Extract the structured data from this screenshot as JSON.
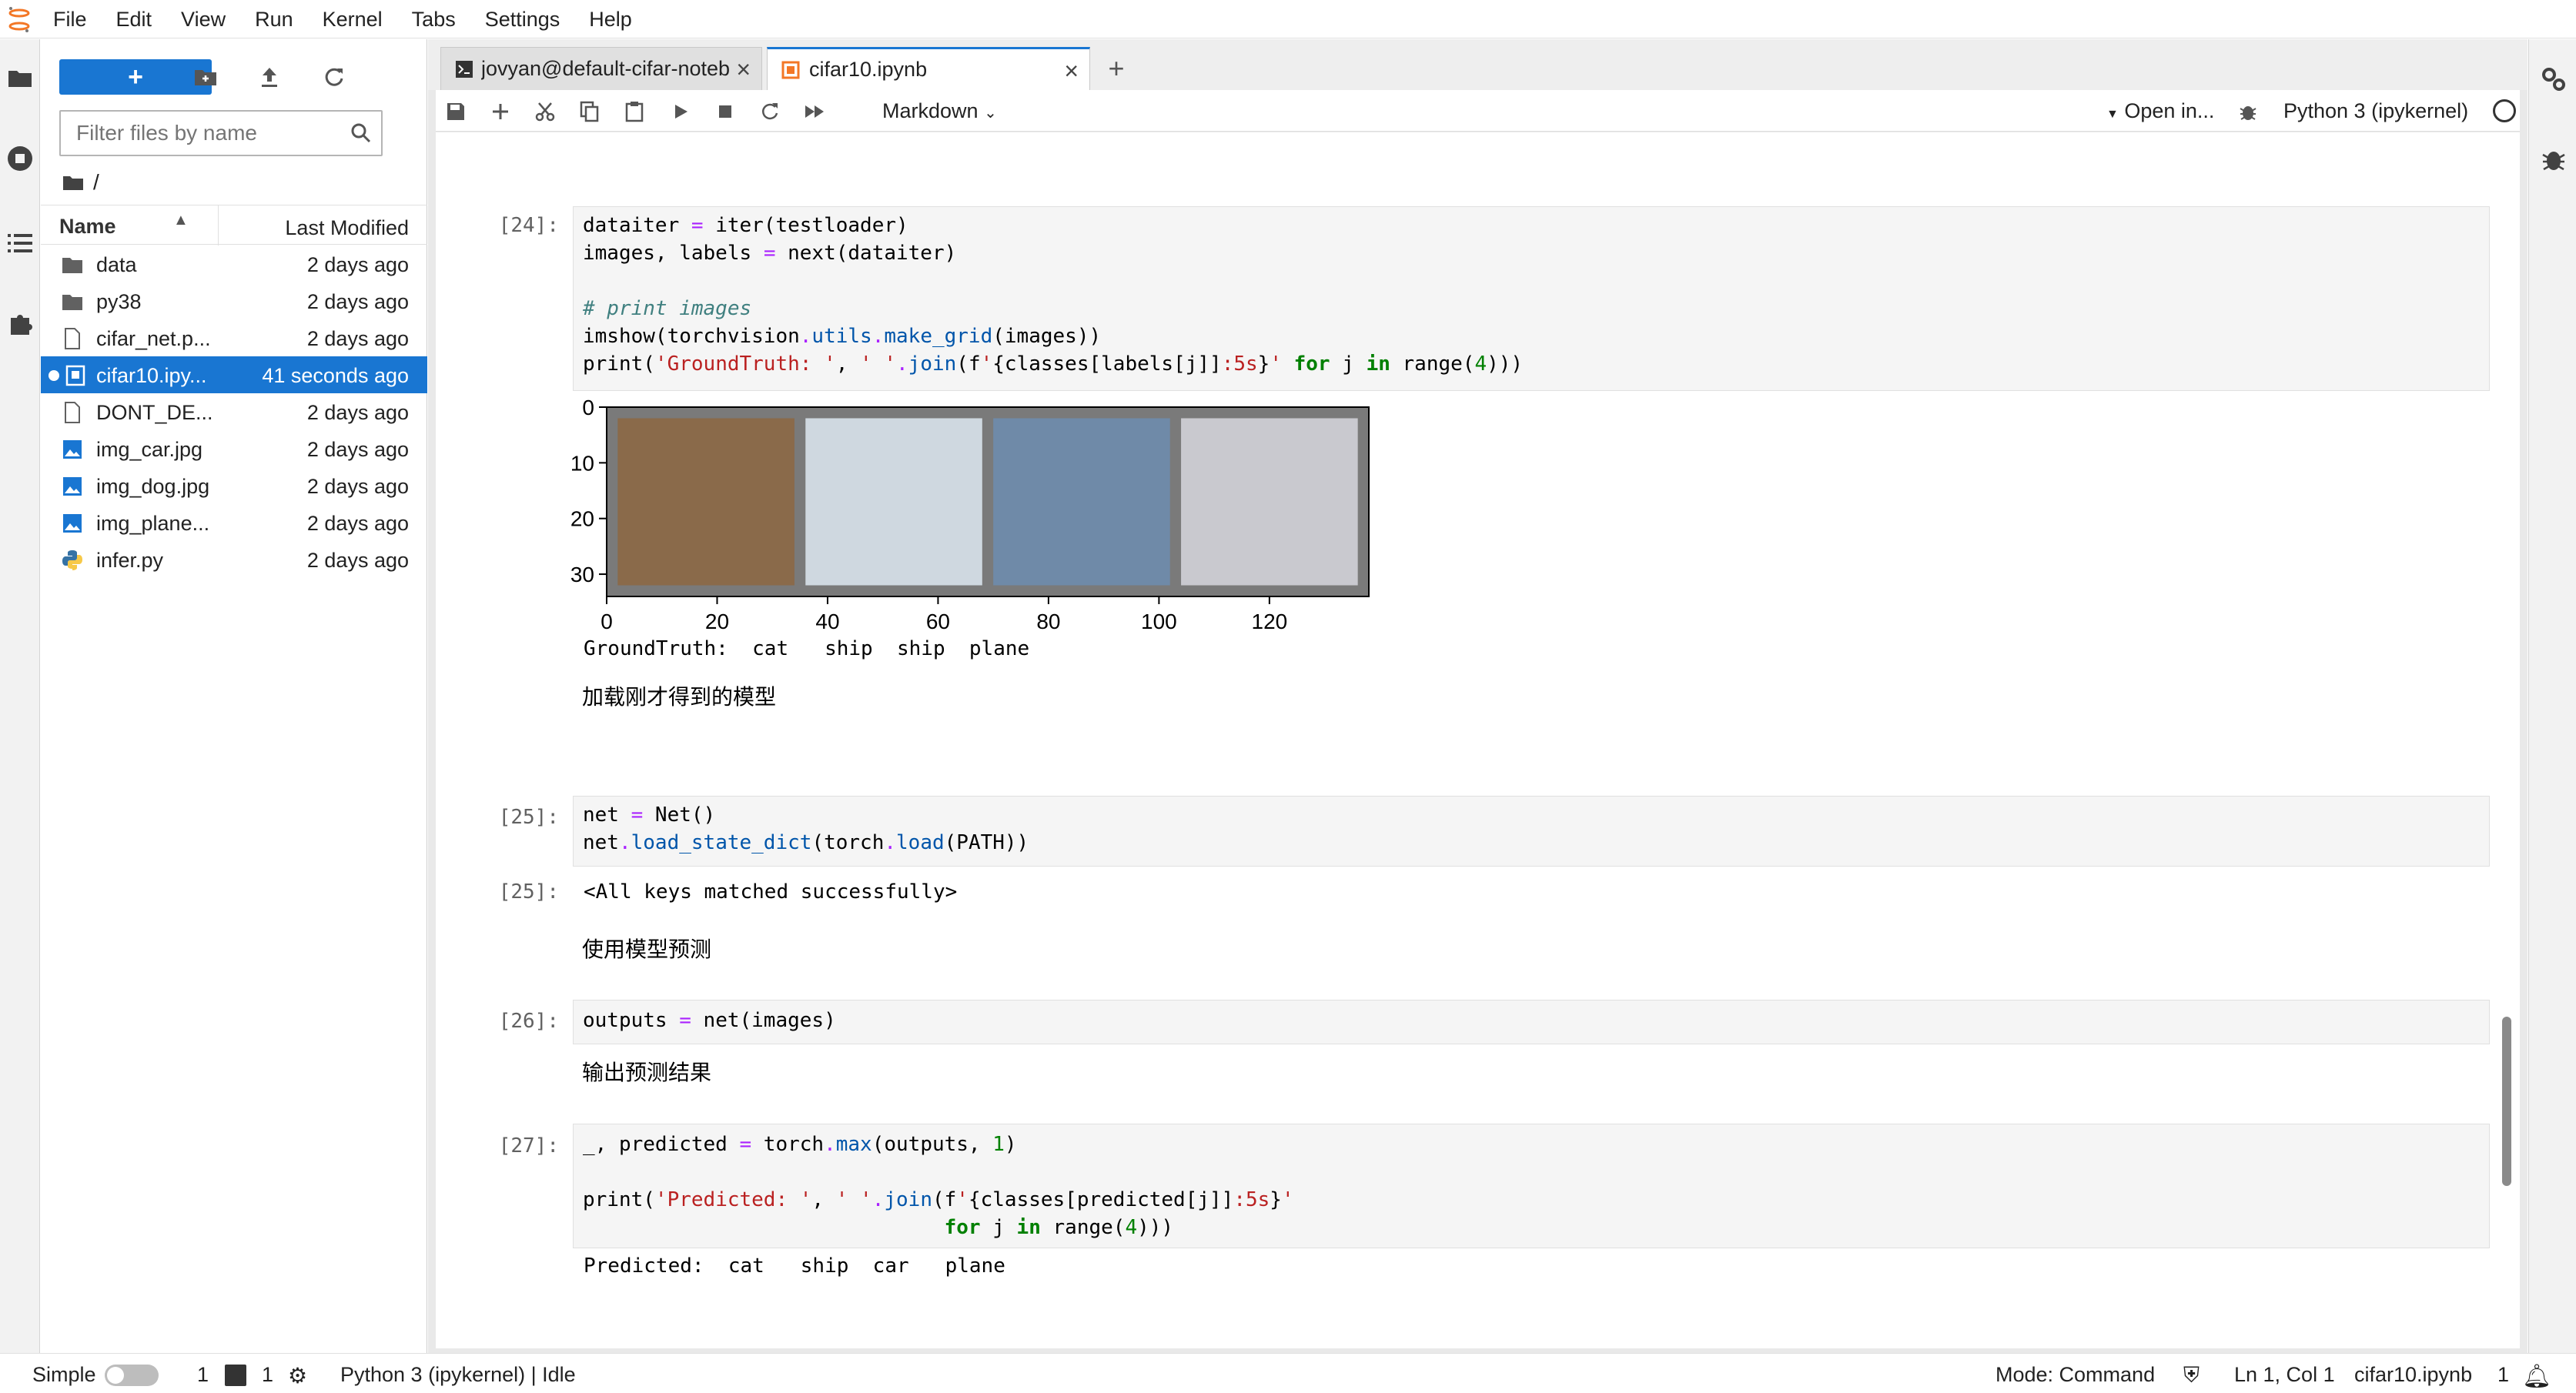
{
  "menu": [
    "File",
    "Edit",
    "View",
    "Run",
    "Kernel",
    "Tabs",
    "Settings",
    "Help"
  ],
  "filebrowser": {
    "new_label": "+",
    "filter_placeholder": "Filter files by name",
    "breadcrumb": "/",
    "col_name": "Name",
    "col_modified": "Last Modified",
    "files": [
      {
        "name": "data",
        "modified": "2 days ago",
        "icon": "folder-icon"
      },
      {
        "name": "py38",
        "modified": "2 days ago",
        "icon": "folder-icon"
      },
      {
        "name": "cifar_net.p...",
        "modified": "2 days ago",
        "icon": "file-icon"
      },
      {
        "name": "cifar10.ipy...",
        "modified": "41 seconds ago",
        "icon": "notebook-icon"
      },
      {
        "name": "DONT_DE...",
        "modified": "2 days ago",
        "icon": "file-icon"
      },
      {
        "name": "img_car.jpg",
        "modified": "2 days ago",
        "icon": "image-icon"
      },
      {
        "name": "img_dog.jpg",
        "modified": "2 days ago",
        "icon": "image-icon"
      },
      {
        "name": "img_plane...",
        "modified": "2 days ago",
        "icon": "image-icon"
      },
      {
        "name": "infer.py",
        "modified": "2 days ago",
        "icon": "python-icon"
      }
    ]
  },
  "tabs": [
    {
      "label": "jovyan@default-cifar-noteb"
    },
    {
      "label": "cifar10.ipynb"
    }
  ],
  "toolbar": {
    "cell_type": "Markdown",
    "open_in": "Open in...",
    "kernel": "Python 3 (ipykernel)"
  },
  "cells": {
    "c24_prompt": "[24]:",
    "c24_l1": "dataiter = iter(testloader)",
    "c24_l2": "images, labels = next(dataiter)",
    "c24_l3": "# print images",
    "c24_l4": "imshow(torchvision.utils.make_grid(images))",
    "c24_l5": "print('GroundTruth: ', ' '.join(f'{classes[labels[j]]:5s}' for j in range(4)))",
    "c24_out": "GroundTruth:  cat   ship  ship  plane",
    "md1": "加载刚才得到的模型",
    "c25_prompt": "[25]:",
    "c25_l1": "net = Net()",
    "c25_l2": "net.load_state_dict(torch.load(PATH))",
    "c25_out_prompt": "[25]:",
    "c25_out": "<All keys matched successfully>",
    "md2": "使用模型预测",
    "c26_prompt": "[26]:",
    "c26_l1": "outputs = net(images)",
    "md3": "输出预测结果",
    "c27_prompt": "[27]:",
    "c27_l1": "_, predicted = torch.max(outputs, 1)",
    "c27_l2": "print('Predicted: ', ' '.join(f'{classes[predicted[j]]:5s}'",
    "c27_l3": "                              for j in range(4)))",
    "c27_out": "Predicted:  cat   ship  car   plane"
  },
  "chart_data": {
    "type": "image",
    "xticks": [
      "0",
      "20",
      "40",
      "60",
      "80",
      "100",
      "120"
    ],
    "yticks": [
      "0",
      "10",
      "20",
      "30"
    ],
    "xlim": [
      0,
      138
    ],
    "ylim": [
      34,
      0
    ],
    "image_colors": [
      "#8a6a4a",
      "#cfd8e0",
      "#6f8aa8",
      "#c9c9cf"
    ]
  },
  "status": {
    "mode_label": "Simple",
    "count1": "1",
    "count2": "1",
    "kernel_status": "Python 3 (ipykernel) | Idle",
    "mode": "Mode: Command",
    "cursor": "Ln 1, Col 1",
    "file": "cifar10.ipynb",
    "notif": "1"
  },
  "colors": {
    "accent": "#1976d2",
    "string": "#ba2121",
    "keyword": "#008000",
    "operator": "#aa22ff"
  }
}
